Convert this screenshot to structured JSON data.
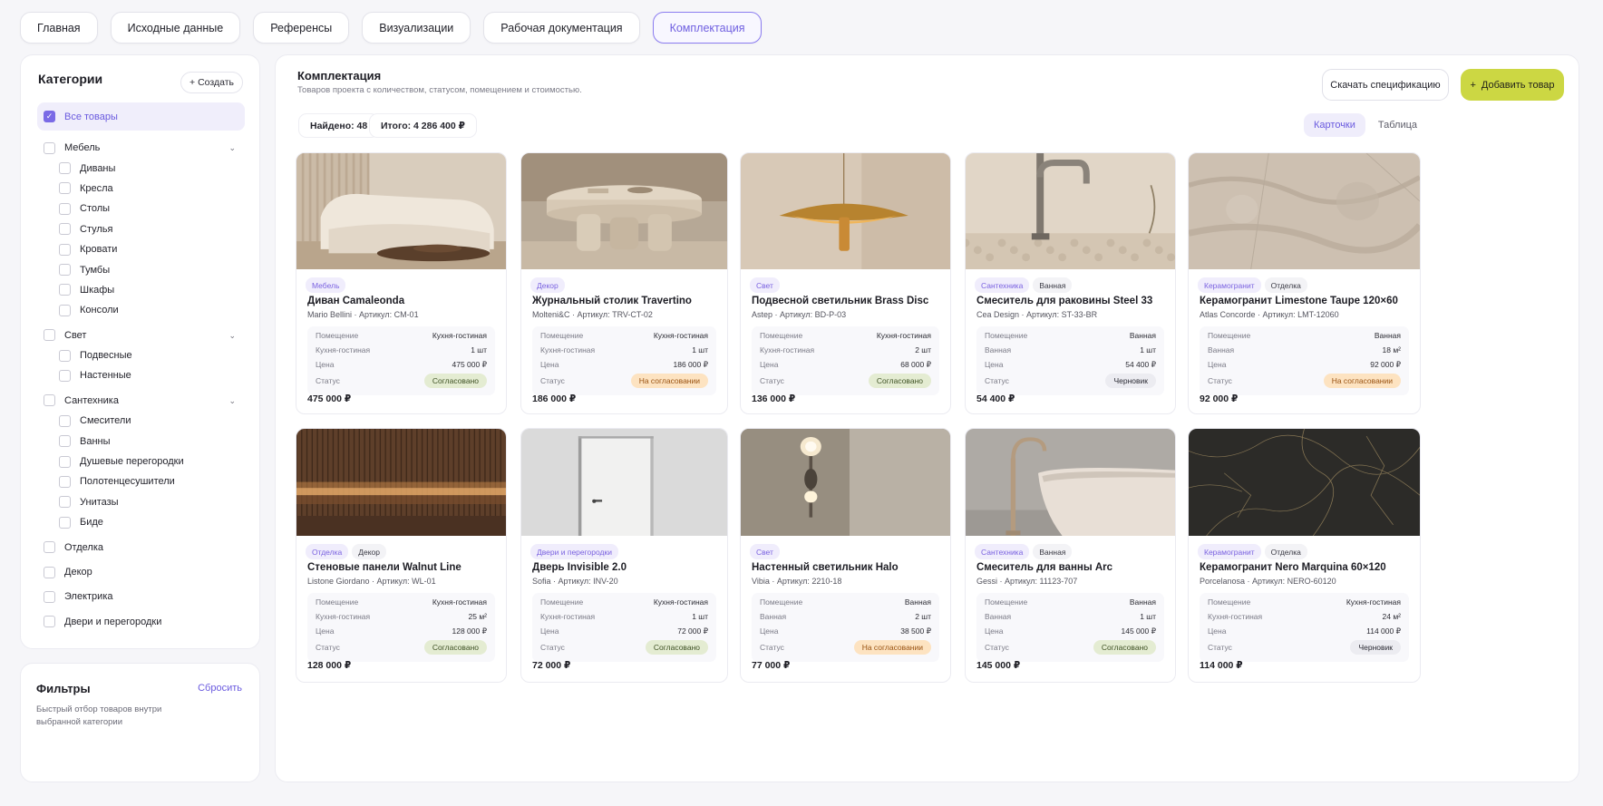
{
  "tabs": [
    "Главная",
    "Исходные данные",
    "Референсы",
    "Визуализации",
    "Рабочая документация",
    "Комплектация"
  ],
  "sidebar": {
    "title": "Категории",
    "create_label": "+ Создать",
    "all_label": "Все товары",
    "groups": [
      {
        "label": "Мебель",
        "items": [
          "Диваны",
          "Кресла",
          "Столы",
          "Стулья",
          "Кровати",
          "Тумбы",
          "Шкафы",
          "Консоли"
        ]
      },
      {
        "label": "Свет",
        "items": [
          "Подвесные",
          "Настенные"
        ]
      },
      {
        "label": "Сантехника",
        "items": [
          "Смесители",
          "Ванны",
          "Душевые перегородки",
          "Полотенцесушители",
          "Унитазы",
          "Биде"
        ]
      },
      {
        "label": "Отделка",
        "items": []
      },
      {
        "label": "Декор",
        "items": []
      },
      {
        "label": "Электрика",
        "items": []
      },
      {
        "label": "Двери и перегородки",
        "items": []
      }
    ]
  },
  "filters": {
    "title": "Фильтры",
    "reset_label": "Сбросить",
    "description": "Быстрый отбор товаров внутри выбранной категории"
  },
  "main": {
    "title": "Комплектация",
    "subtitle": "Товаров проекта с количеством, статусом, помещением и стоимостью.",
    "download_label": "Скачать спецификацию",
    "add_label": "Добавить товар",
    "add_icon": "+",
    "found": "Найдено: 48",
    "total": "Итого: 4 286 400 ₽",
    "view_cards": "Карточки",
    "view_table": "Таблица"
  },
  "card_labels": {
    "room": "Помещение",
    "price": "Цена",
    "status": "Статус"
  },
  "products": [
    {
      "category": "Мебель",
      "room_tag": "",
      "title": "Диван Camaleonda",
      "meta": "Mario Bellini · Артикул: CM-01",
      "room": "Кухня-гостиная",
      "qty_label": "Кухня-гостиная",
      "qty": "1 шт",
      "price": "475 000 ₽",
      "status": "Согласовано",
      "status_color": "green",
      "total": "475 000 ₽",
      "image": "sofa"
    },
    {
      "category": "Декор",
      "room_tag": "",
      "title": "Журнальный столик Travertino",
      "meta": "Molteni&C · Артикул: TRV-CT-02",
      "room": "Кухня-гостиная",
      "qty_label": "Кухня-гостиная",
      "qty": "1 шт",
      "price": "186 000 ₽",
      "status": "На согласовании",
      "status_color": "orange",
      "total": "186 000 ₽",
      "image": "table"
    },
    {
      "category": "Свет",
      "room_tag": "",
      "title": "Подвесной светильник Brass Disc",
      "meta": "Astep · Артикул: BD-P-03",
      "room": "Кухня-гостиная",
      "qty_label": "Кухня-гостиная",
      "qty": "2 шт",
      "price": "68 000 ₽",
      "status": "Согласовано",
      "status_color": "green",
      "total": "136 000 ₽",
      "image": "pendant"
    },
    {
      "category": "Сантехника",
      "room_tag": "Ванная",
      "title": "Смеситель для раковины Steel 33",
      "meta": "Cea Design · Артикул: ST-33-BR",
      "room": "Ванная",
      "qty_label": "Ванная",
      "qty": "1 шт",
      "price": "54 400 ₽",
      "status": "Черновик",
      "status_color": "gray",
      "total": "54 400 ₽",
      "image": "faucet"
    },
    {
      "category": "Керамогранит",
      "room_tag": "Отделка",
      "title": "Керамогранит Limestone Taupe 120×60",
      "meta": "Atlas Concorde · Артикул: LMT-12060",
      "room": "Ванная",
      "qty_label": "Ванная",
      "qty": "18 м²",
      "price": "92 000 ₽",
      "status": "На согласовании",
      "status_color": "orange",
      "total": "92 000 ₽",
      "image": "limestone"
    },
    {
      "category": "Отделка",
      "room_tag": "Декор",
      "title": "Стеновые панели Walnut Line",
      "meta": "Listone Giordano · Артикул: WL-01",
      "room": "Кухня-гостиная",
      "qty_label": "Кухня-гостиная",
      "qty": "25 м²",
      "price": "128 000 ₽",
      "status": "Согласовано",
      "status_color": "green",
      "total": "128 000 ₽",
      "image": "walnut"
    },
    {
      "category": "Двери и перегородки",
      "room_tag": "",
      "title": "Дверь Invisible 2.0",
      "meta": "Sofia · Артикул: INV-20",
      "room": "Кухня-гостиная",
      "qty_label": "Кухня-гостиная",
      "qty": "1 шт",
      "price": "72 000 ₽",
      "status": "Согласовано",
      "status_color": "green",
      "total": "72 000 ₽",
      "image": "door"
    },
    {
      "category": "Свет",
      "room_tag": "",
      "title": "Настенный светильник Halo",
      "meta": "Vibia · Артикул: 2210-18",
      "room": "Ванная",
      "qty_label": "Ванная",
      "qty": "2 шт",
      "price": "38 500 ₽",
      "status": "На согласовании",
      "status_color": "orange",
      "total": "77 000 ₽",
      "image": "sconce"
    },
    {
      "category": "Сантехника",
      "room_tag": "Ванная",
      "title": "Смеситель для ванны Arc",
      "meta": "Gessi · Артикул: 11123-707",
      "room": "Ванная",
      "qty_label": "Ванная",
      "qty": "1 шт",
      "price": "145 000 ₽",
      "status": "Согласовано",
      "status_color": "green",
      "total": "145 000 ₽",
      "image": "bath"
    },
    {
      "category": "Керамогранит",
      "room_tag": "Отделка",
      "title": "Керамогранит Nero Marquina 60×120",
      "meta": "Porcelanosa · Артикул: NERO-60120",
      "room": "Кухня-гостиная",
      "qty_label": "Кухня-гостиная",
      "qty": "24 м²",
      "price": "114 000 ₽",
      "status": "Черновик",
      "status_color": "gray",
      "total": "114 000 ₽",
      "image": "marble"
    }
  ]
}
